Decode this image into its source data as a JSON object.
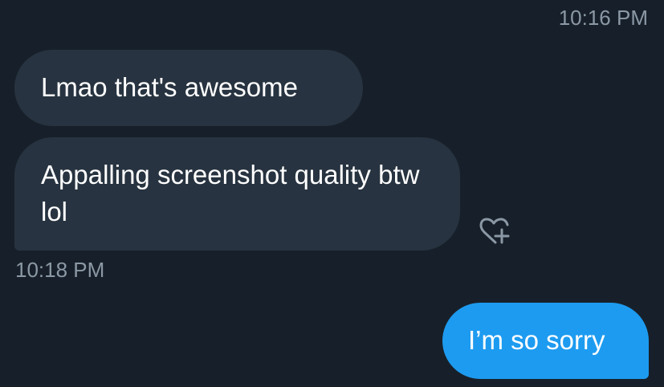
{
  "conversation": {
    "timestamp_top": "10:16 PM",
    "timestamp_middle": "10:18 PM",
    "messages": [
      {
        "direction": "received",
        "text": "Lmao that's awesome"
      },
      {
        "direction": "received",
        "text": "Appalling screenshot quality btw lol"
      },
      {
        "direction": "sent",
        "text": "I’m so sorry"
      }
    ],
    "reaction_button_icon": "heart-plus-icon"
  },
  "colors": {
    "background": "#17202a",
    "received_bubble": "#273340",
    "sent_bubble": "#1d9bf0",
    "timestamp_text": "#8b98a5",
    "icon": "#8b98a5"
  }
}
